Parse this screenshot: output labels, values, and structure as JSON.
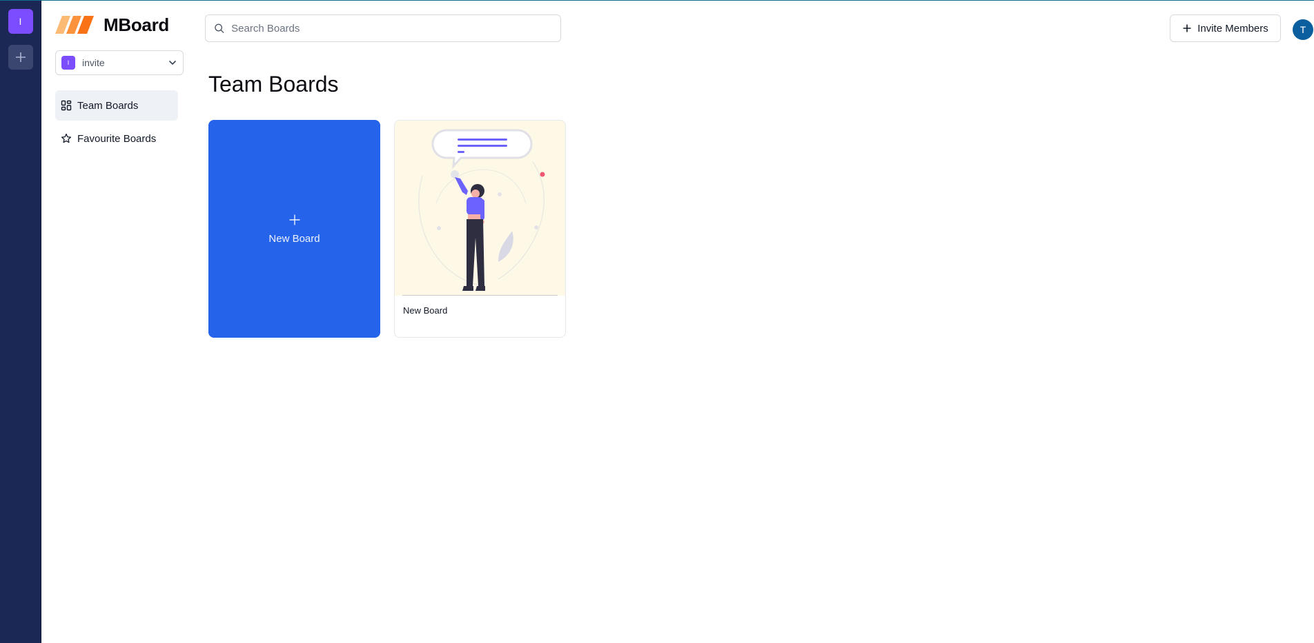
{
  "org_rail": {
    "org_initial": "I"
  },
  "sidebar": {
    "logo_text": "MBoard",
    "org_select": {
      "initial": "I",
      "label": "invite"
    },
    "nav": [
      {
        "label": "Team Boards",
        "icon": "dashboard-icon",
        "active": true
      },
      {
        "label": "Favourite Boards",
        "icon": "star-icon",
        "active": false
      }
    ]
  },
  "header": {
    "search_placeholder": "Search Boards",
    "invite_label": "Invite Members",
    "avatar_initial": "T"
  },
  "main": {
    "title": "Team Boards",
    "new_board_label": "New Board",
    "boards": [
      {
        "title": "New Board"
      }
    ]
  },
  "colors": {
    "rail_bg": "#1b2754",
    "org_accent": "#7c4dff",
    "new_board_bg": "#2563eb",
    "avatar_bg": "#0b5f9f",
    "logo_orange": "#f97316"
  }
}
